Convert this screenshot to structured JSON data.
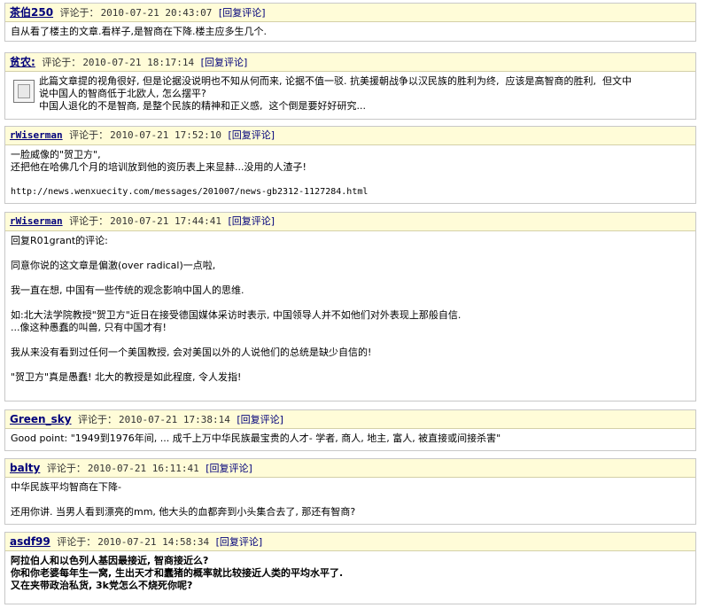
{
  "comments": [
    {
      "author": "茶伯250",
      "label": "评论于：",
      "time": "2010-07-21 20:43:07",
      "reply": "[回复评论]",
      "lines": [
        "自从看了楼主的文章.看样子,是智商在下降.楼主应多生几个."
      ]
    },
    {
      "author": "贫农:",
      "label": "评论于：",
      "time": "2010-07-21 18:17:14",
      "reply": "[回复评论]",
      "lines": [
        "此篇文章提的视角很好, 但是论据没说明也不知从何而来, 论据不值一驳. 抗美援朝战争以汉民族的胜利为终,  应该是高智商的胜利,  但文中",
        "说中国人的智商低于北欧人, 怎么摆平?",
        "中国人退化的不是智商, 是整个民族的精神和正义感,  这个倒是要好好研究..."
      ]
    },
    {
      "author": "rWiserman",
      "label": "评论于：",
      "time": "2010-07-21 17:52:10",
      "reply": "[回复评论]",
      "lines": [
        "一脸威像的\"贺卫方\",",
        "还把他在哈佛几个月的培训放到他的资历表上来显赫...没用的人渣子!",
        "",
        "http://news.wenxuecity.com/messages/201007/news-gb2312-1127284.html"
      ]
    },
    {
      "author": "rWiserman",
      "label": "评论于：",
      "time": "2010-07-21 17:44:41",
      "reply": "[回复评论]",
      "lines": [
        "回复R01grant的评论:",
        "",
        "同意你说的这文章是偏激(over radical)一点啦,",
        "",
        "我一直在想, 中国有一些传统的观念影响中国人的思维.",
        "",
        "如:北大法学院教授\"贺卫方\"近日在接受德国媒体采访时表示, 中国领导人并不如他们对外表现上那般自信.",
        "...像这种愚蠢的叫兽, 只有中国才有!",
        "",
        "我从来没有看到过任何一个美国教授, 会对美国以外的人说他们的总统是缺少自信的!",
        "",
        "\"贺卫方\"真是愚蠢! 北大的教授是如此程度, 令人发指!"
      ]
    },
    {
      "author": "Green_sky",
      "label": "评论于：",
      "time": "2010-07-21 17:38:14",
      "reply": "[回复评论]",
      "lines": [
        "Good point: \"1949到1976年间, ... 成千上万中华民族最宝贵的人才- 学者, 商人, 地主, 富人, 被直接或间接杀害\""
      ]
    },
    {
      "author": "balty",
      "label": "评论于：",
      "time": "2010-07-21 16:11:41",
      "reply": "[回复评论]",
      "lines": [
        "中华民族平均智商在下降-",
        "",
        "还用你讲. 当男人看到漂亮的mm, 他大头的血都奔到小头集合去了, 那还有智商?"
      ]
    },
    {
      "author": "asdf99",
      "label": "评论于：",
      "time": "2010-07-21 14:58:34",
      "reply": "[回复评论]",
      "lines": [
        "阿拉伯人和以色列人基因最接近, 智商接近么?",
        "你和你老婆每年生一窝, 生出天才和蠢猪的概率就比较接近人类的平均水平了.",
        "又在夹带政治私货, 3k党怎么不烧死你呢?"
      ]
    }
  ]
}
